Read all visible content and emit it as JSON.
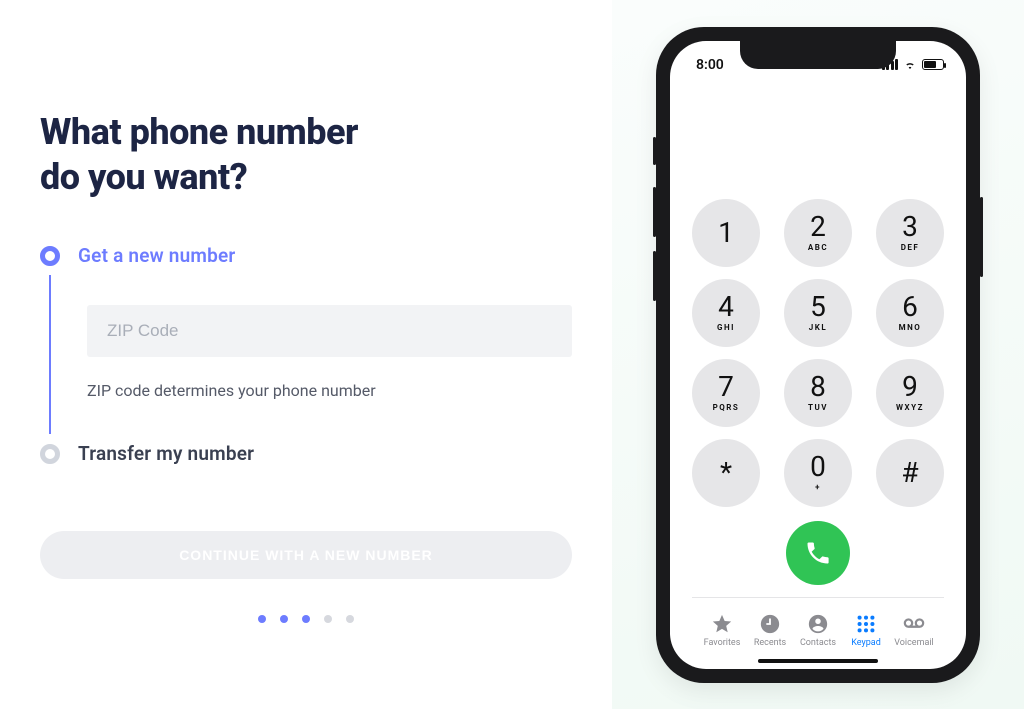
{
  "heading_line1": "What phone number",
  "heading_line2": "do you want?",
  "option1": {
    "label": "Get a new number",
    "selected": true
  },
  "zip": {
    "placeholder": "ZIP Code",
    "value": "",
    "hint": "ZIP code determines your phone number"
  },
  "option2": {
    "label": "Transfer my number",
    "selected": false
  },
  "continue_label": "CONTINUE WITH A NEW NUMBER",
  "progress": {
    "total": 5,
    "active": [
      1,
      2,
      3
    ]
  },
  "phone_status": {
    "time": "8:00"
  },
  "keypad": [
    {
      "num": "1",
      "sub": ""
    },
    {
      "num": "2",
      "sub": "ABC"
    },
    {
      "num": "3",
      "sub": "DEF"
    },
    {
      "num": "4",
      "sub": "GHI"
    },
    {
      "num": "5",
      "sub": "JKL"
    },
    {
      "num": "6",
      "sub": "MNO"
    },
    {
      "num": "7",
      "sub": "PQRS"
    },
    {
      "num": "8",
      "sub": "TUV"
    },
    {
      "num": "9",
      "sub": "WXYZ"
    },
    {
      "num": "*",
      "sub": ""
    },
    {
      "num": "0",
      "sub": "+"
    },
    {
      "num": "#",
      "sub": ""
    }
  ],
  "tabs": [
    {
      "name": "Favorites",
      "active": false
    },
    {
      "name": "Recents",
      "active": false
    },
    {
      "name": "Contacts",
      "active": false
    },
    {
      "name": "Keypad",
      "active": true
    },
    {
      "name": "Voicemail",
      "active": false
    }
  ]
}
